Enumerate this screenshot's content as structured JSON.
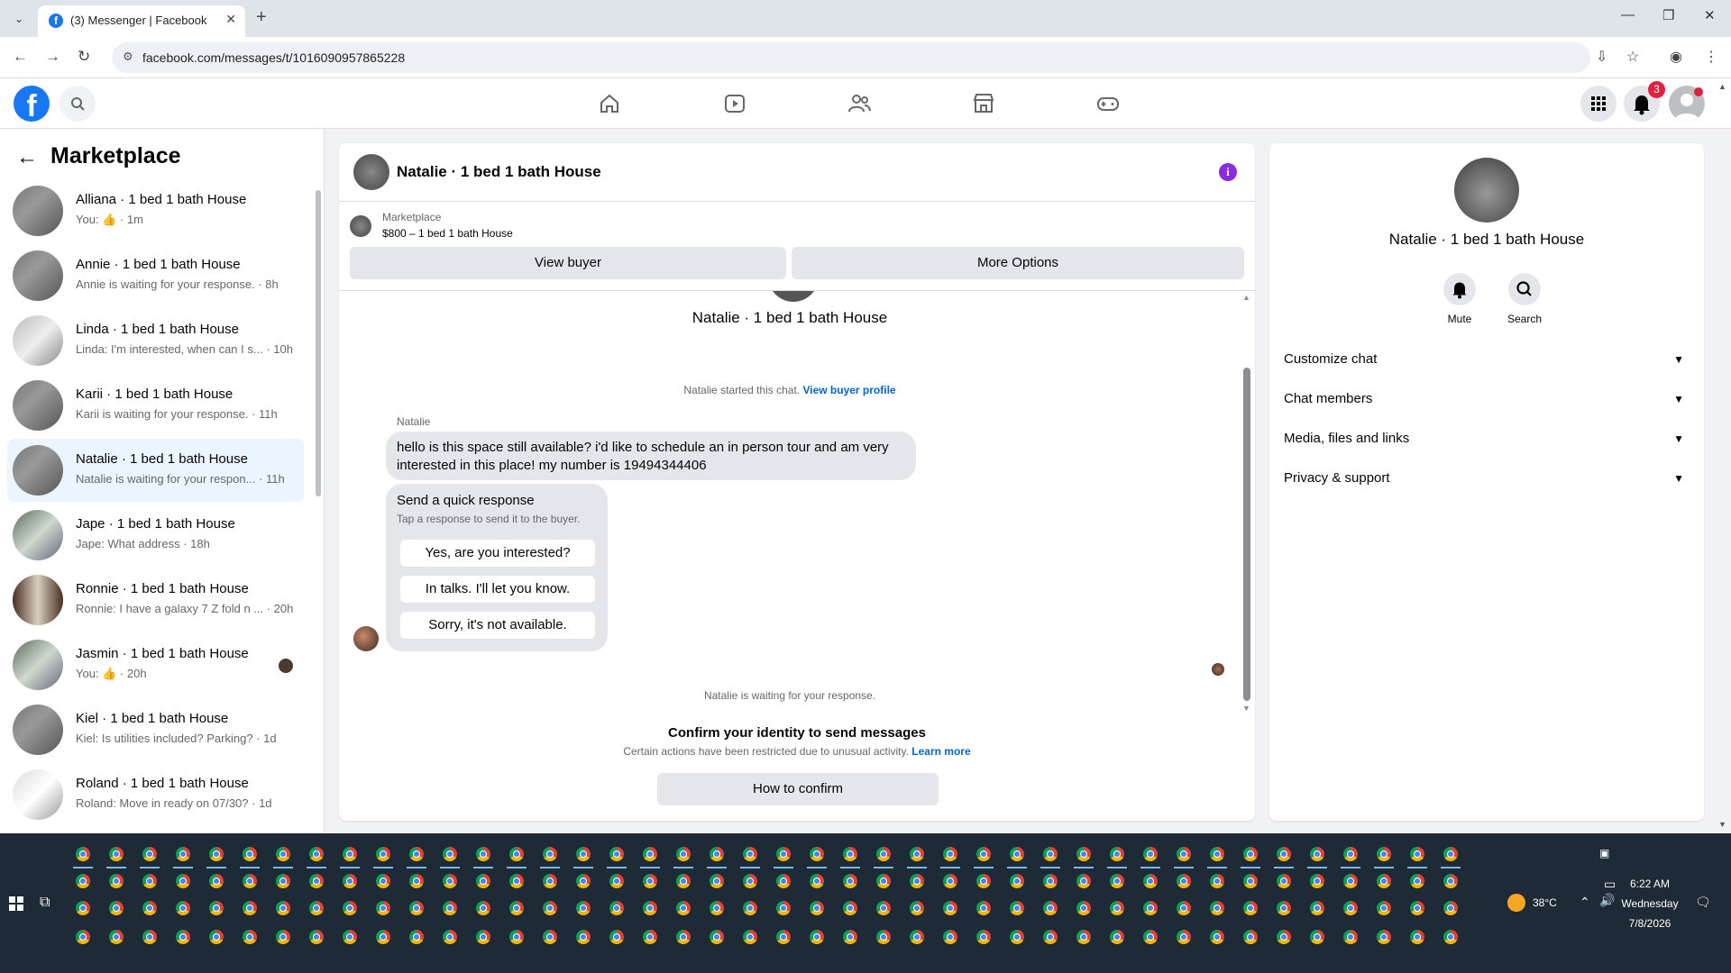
{
  "browser": {
    "tab_title": "(3) Messenger | Facebook",
    "url": "facebook.com/messages/t/1016090957865228"
  },
  "fbnav": {
    "notification_count": "3",
    "icons": [
      "home-icon",
      "video-icon",
      "friends-icon",
      "marketplace-icon",
      "gaming-icon"
    ]
  },
  "left": {
    "title": "Marketplace",
    "conversations": [
      {
        "name": "Alliana · 1 bed 1 bath House",
        "sub": "You: 👍 · 1m"
      },
      {
        "name": "Annie · 1 bed 1 bath House",
        "sub": "Annie is waiting for your response. · 8h"
      },
      {
        "name": "Linda · 1 bed 1 bath House",
        "sub": "Linda: I'm interested, when can I s... · 10h"
      },
      {
        "name": "Karii · 1 bed 1 bath House",
        "sub": "Karii is waiting for your response. · 11h"
      },
      {
        "name": "Natalie · 1 bed 1 bath House",
        "sub": "Natalie is waiting for your respon... · 11h"
      },
      {
        "name": "Jape · 1 bed 1 bath House",
        "sub": "Jape: What address · 18h"
      },
      {
        "name": "Ronnie · 1 bed 1 bath House",
        "sub": "Ronnie: I have a galaxy 7 Z fold n ... · 20h"
      },
      {
        "name": "Jasmin · 1 bed 1 bath House",
        "sub": "You: 👍 · 20h"
      },
      {
        "name": "Kiel · 1 bed 1 bath House",
        "sub": "Kiel: Is utilities included? Parking? · 1d"
      },
      {
        "name": "Roland · 1 bed 1 bath House",
        "sub": "Roland: Move in ready on 07/30? · 1d"
      }
    ]
  },
  "chat": {
    "title": "Natalie · 1 bed 1 bath House",
    "marketplace_label": "Marketplace",
    "listing": "$800 – 1 bed 1 bath House",
    "view_buyer": "View buyer",
    "more_options": "More Options",
    "center_name": "Natalie · 1 bed 1 bath House",
    "started_text": "Natalie started this chat.",
    "view_buyer_profile": "View buyer profile",
    "sender": "Natalie",
    "message": "hello is this space still available? i'd like to schedule an in person tour and am very interested in this place! my number is 19494344406",
    "quick_title": "Send a quick response",
    "quick_sub": "Tap a response to send it to the buyer.",
    "quick_options": [
      "Yes, are you interested?",
      "In talks. I'll let you know.",
      "Sorry, it's not available."
    ],
    "waiting": "Natalie is waiting for your response.",
    "confirm_title": "Confirm your identity to send messages",
    "confirm_sub": "Certain actions have been restricted due to unusual activity.",
    "learn_more": "Learn more",
    "how_to_confirm": "How to confirm"
  },
  "right": {
    "name": "Natalie · 1 bed 1 bath House",
    "mute": "Mute",
    "search": "Search",
    "sections": [
      "Customize chat",
      "Chat members",
      "Media, files and links",
      "Privacy & support"
    ]
  },
  "taskbar": {
    "temperature": "38°C",
    "time": "6:22 AM",
    "day": "Wednesday",
    "date": "7/8/2026"
  }
}
